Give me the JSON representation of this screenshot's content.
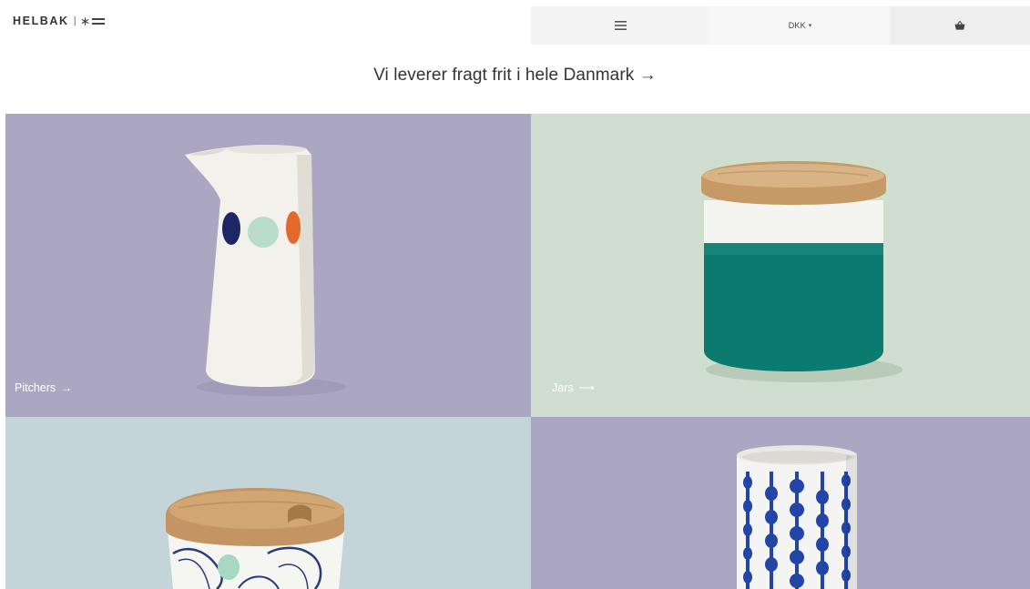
{
  "header": {
    "logo_text": "HELBAK",
    "logo_separator": "|",
    "currency": "DKK",
    "currency_caret": "▾"
  },
  "banner": {
    "text": "Vi leverer fragt frit i hele Danmark →"
  },
  "tiles": [
    {
      "label": "Pitchers",
      "arrow": "→",
      "background": "#aba7c3"
    },
    {
      "label": "Jars",
      "arrow": "⟶",
      "background": "#cfdece"
    },
    {
      "label": "",
      "arrow": "",
      "background": "#c3d5d9"
    },
    {
      "label": "",
      "arrow": "",
      "background": "#aba7c3"
    }
  ],
  "colors": {
    "menu_bg": "#f4f4f4",
    "currency_bg": "#f7f7f7",
    "cart_bg": "#eeeeee",
    "text": "#333333"
  },
  "icons": {
    "logo_mark": "asterisk-icon",
    "logo_lines": "double-line-icon",
    "menu": "hamburger-menu-icon",
    "cart": "basket-icon"
  }
}
